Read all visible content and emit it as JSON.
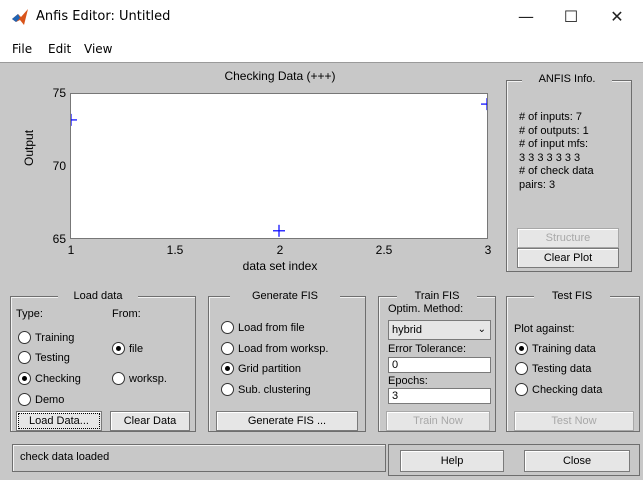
{
  "window": {
    "title": "Anfis Editor: Untitled",
    "minimize": "—",
    "maximize": "☐",
    "close": "✕"
  },
  "menu": [
    "File",
    "Edit",
    "View"
  ],
  "plot": {
    "title": "Checking Data (+++)",
    "ylabel": "Output",
    "xlabel": "data set index"
  },
  "chart_data": {
    "type": "scatter",
    "title": "Checking Data (+++)",
    "xlabel": "data set index",
    "ylabel": "Output",
    "marker": "+",
    "marker_color": "#0000ff",
    "xlim": [
      1,
      3
    ],
    "ylim": [
      65,
      75
    ],
    "xticks": [
      "1",
      "1.5",
      "2",
      "2.5",
      "3"
    ],
    "yticks": [
      "75",
      "70",
      "65"
    ],
    "x": [
      1,
      2,
      3
    ],
    "y": [
      73.2,
      65.5,
      74.3
    ]
  },
  "anfis_info": {
    "title": "ANFIS Info.",
    "lines": [
      "# of inputs: 7",
      "# of outputs: 1",
      "# of input mfs:",
      "3 3 3 3 3 3 3",
      "# of check data",
      "pairs: 3"
    ],
    "structure_button": "Structure",
    "clear_plot_button": "Clear Plot"
  },
  "load_data": {
    "title": "Load data",
    "type_label": "Type:",
    "from_label": "From:",
    "types": [
      {
        "label": "Training",
        "selected": false
      },
      {
        "label": "Testing",
        "selected": false
      },
      {
        "label": "Checking",
        "selected": true
      },
      {
        "label": "Demo",
        "selected": false
      }
    ],
    "sources": [
      {
        "label": "file",
        "selected": true
      },
      {
        "label": "worksp.",
        "selected": false
      }
    ],
    "load_button": "Load Data...",
    "clear_button": "Clear Data"
  },
  "generate_fis": {
    "title": "Generate FIS",
    "options": [
      {
        "label": "Load from file",
        "selected": false
      },
      {
        "label": "Load from worksp.",
        "selected": false
      },
      {
        "label": "Grid partition",
        "selected": true
      },
      {
        "label": "Sub. clustering",
        "selected": false
      }
    ],
    "button": "Generate FIS ..."
  },
  "train_fis": {
    "title": "Train FIS",
    "method_label": "Optim. Method:",
    "method_value": "hybrid",
    "tolerance_label": "Error Tolerance:",
    "tolerance_value": "0",
    "epochs_label": "Epochs:",
    "epochs_value": "3",
    "button": "Train Now"
  },
  "test_fis": {
    "title": "Test FIS",
    "plot_against_label": "Plot against:",
    "options": [
      {
        "label": "Training data",
        "selected": true
      },
      {
        "label": "Testing data",
        "selected": false
      },
      {
        "label": "Checking data",
        "selected": false
      }
    ],
    "button": "Test Now"
  },
  "status": {
    "message": "check data loaded",
    "help_button": "Help",
    "close_button": "Close"
  },
  "colors": {
    "panel_bg": "#c8c8c8",
    "marker": "#0000ff"
  }
}
